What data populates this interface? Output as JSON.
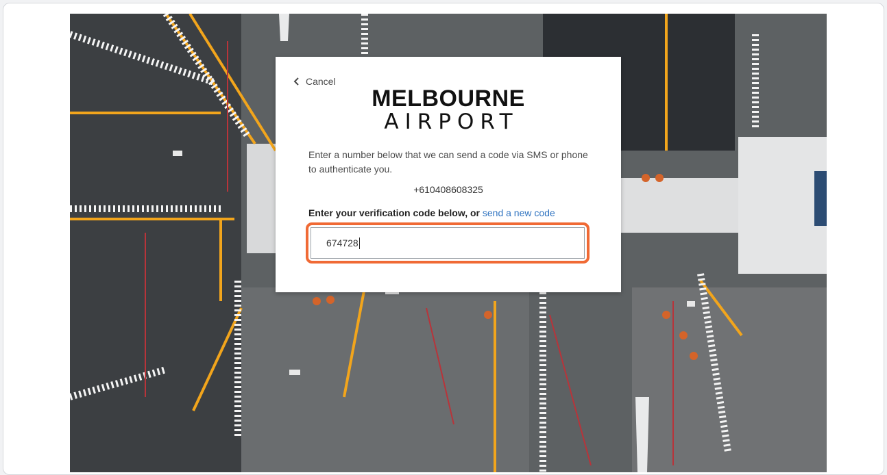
{
  "background": {
    "image_name": "airport-apron-aerial-photo"
  },
  "card": {
    "cancel_label": "Cancel",
    "logo_line1": "MELBOURNE",
    "logo_line2": "AIRPORT",
    "intro_text": "Enter a number below that we can send a code via SMS or phone to authenticate you.",
    "phone_number": "+610408608325",
    "code_label": "Enter your verification code below, or",
    "resend_link": "send a new code",
    "code_value": "674728"
  },
  "colors": {
    "highlight": "#f06a35",
    "link": "#2f73c0"
  },
  "icons": {
    "cancel": "chevron-left-icon"
  }
}
